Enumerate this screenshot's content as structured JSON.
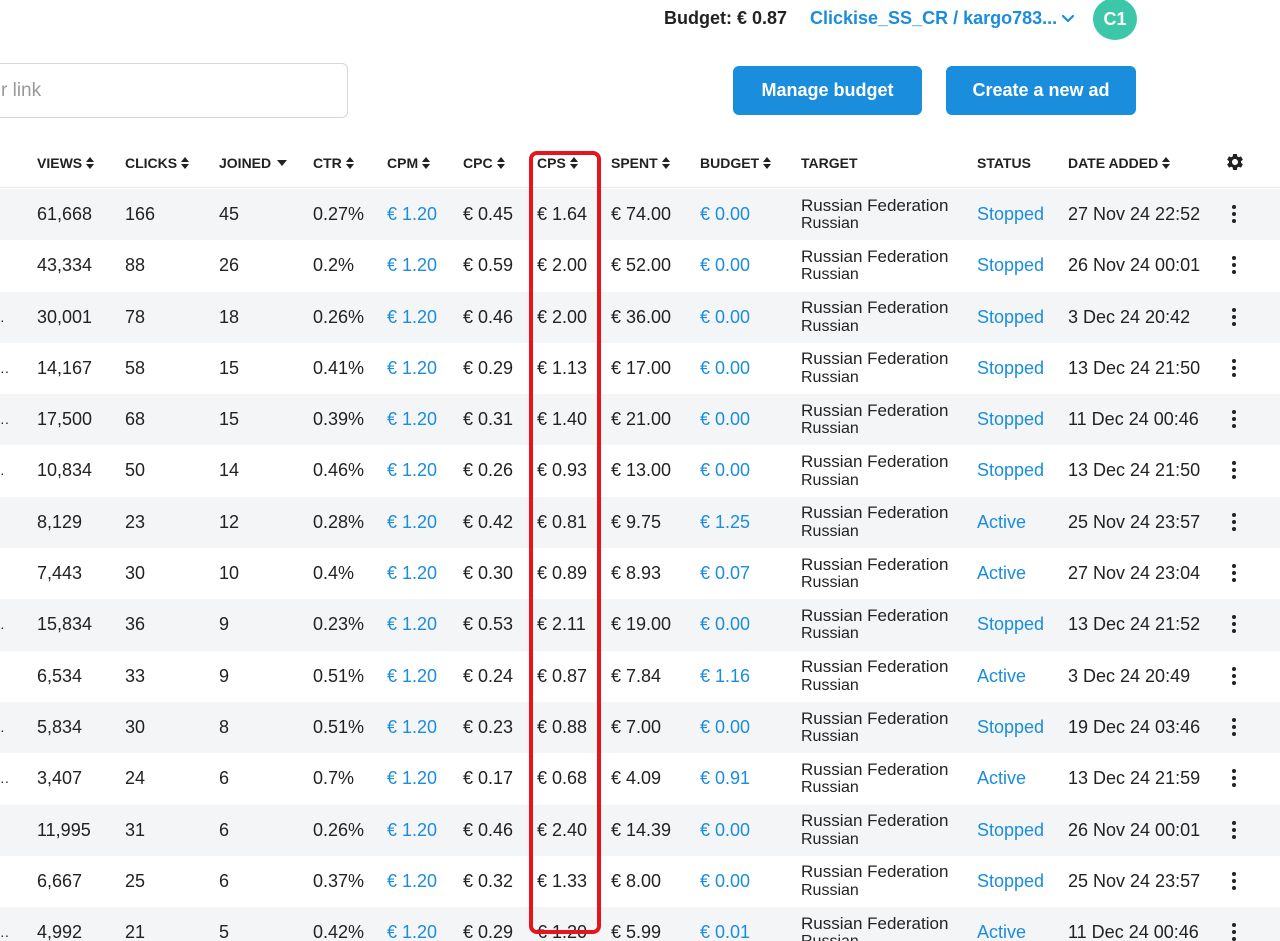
{
  "header": {
    "budget_label": "Budget: € 0.87",
    "account_name": "Clickise_SS_CR / kargo783...",
    "avatar_initials": "C1"
  },
  "search": {
    "placeholder": "r link"
  },
  "actions": {
    "manage_budget": "Manage budget",
    "create_ad": "Create a new ad"
  },
  "columns": {
    "views": "VIEWS",
    "clicks": "CLICKS",
    "joined": "JOINED",
    "ctr": "CTR",
    "cpm": "CPM",
    "cpc": "CPC",
    "cps": "CPS",
    "spent": "SPENT",
    "budget": "BUDGET",
    "target": "TARGET",
    "status": "STATUS",
    "date_added": "DATE ADDED"
  },
  "rows": [
    {
      "marker": "",
      "views": "61,668",
      "clicks": "166",
      "joined": "45",
      "ctr": "0.27%",
      "cpm": "€ 1.20",
      "cpc": "€ 0.45",
      "cps": "€ 1.64",
      "spent": "€ 74.00",
      "budget": "€ 0.00",
      "country": "Russian Federation",
      "lang": "Russian",
      "status": "Stopped",
      "date": "27 Nov 24 22:52"
    },
    {
      "marker": "",
      "views": "43,334",
      "clicks": "88",
      "joined": "26",
      "ctr": "0.2%",
      "cpm": "€ 1.20",
      "cpc": "€ 0.59",
      "cps": "€ 2.00",
      "spent": "€ 52.00",
      "budget": "€ 0.00",
      "country": "Russian Federation",
      "lang": "Russian",
      "status": "Stopped",
      "date": "26 Nov 24 00:01"
    },
    {
      "marker": "·",
      "views": "30,001",
      "clicks": "78",
      "joined": "18",
      "ctr": "0.26%",
      "cpm": "€ 1.20",
      "cpc": "€ 0.46",
      "cps": "€ 2.00",
      "spent": "€ 36.00",
      "budget": "€ 0.00",
      "country": "Russian Federation",
      "lang": "Russian",
      "status": "Stopped",
      "date": "3 Dec 24 20:42"
    },
    {
      "marker": "··",
      "views": "14,167",
      "clicks": "58",
      "joined": "15",
      "ctr": "0.41%",
      "cpm": "€ 1.20",
      "cpc": "€ 0.29",
      "cps": "€ 1.13",
      "spent": "€ 17.00",
      "budget": "€ 0.00",
      "country": "Russian Federation",
      "lang": "Russian",
      "status": "Stopped",
      "date": "13 Dec 24 21:50"
    },
    {
      "marker": "··",
      "views": "17,500",
      "clicks": "68",
      "joined": "15",
      "ctr": "0.39%",
      "cpm": "€ 1.20",
      "cpc": "€ 0.31",
      "cps": "€ 1.40",
      "spent": "€ 21.00",
      "budget": "€ 0.00",
      "country": "Russian Federation",
      "lang": "Russian",
      "status": "Stopped",
      "date": "11 Dec 24 00:46"
    },
    {
      "marker": "·",
      "views": "10,834",
      "clicks": "50",
      "joined": "14",
      "ctr": "0.46%",
      "cpm": "€ 1.20",
      "cpc": "€ 0.26",
      "cps": "€ 0.93",
      "spent": "€ 13.00",
      "budget": "€ 0.00",
      "country": "Russian Federation",
      "lang": "Russian",
      "status": "Stopped",
      "date": "13 Dec 24 21:50"
    },
    {
      "marker": "",
      "views": "8,129",
      "clicks": "23",
      "joined": "12",
      "ctr": "0.28%",
      "cpm": "€ 1.20",
      "cpc": "€ 0.42",
      "cps": "€ 0.81",
      "spent": "€ 9.75",
      "budget": "€ 1.25",
      "country": "Russian Federation",
      "lang": "Russian",
      "status": "Active",
      "date": "25 Nov 24 23:57"
    },
    {
      "marker": "",
      "views": "7,443",
      "clicks": "30",
      "joined": "10",
      "ctr": "0.4%",
      "cpm": "€ 1.20",
      "cpc": "€ 0.30",
      "cps": "€ 0.89",
      "spent": "€ 8.93",
      "budget": "€ 0.07",
      "country": "Russian Federation",
      "lang": "Russian",
      "status": "Active",
      "date": "27 Nov 24 23:04"
    },
    {
      "marker": "·",
      "views": "15,834",
      "clicks": "36",
      "joined": "9",
      "ctr": "0.23%",
      "cpm": "€ 1.20",
      "cpc": "€ 0.53",
      "cps": "€ 2.11",
      "spent": "€ 19.00",
      "budget": "€ 0.00",
      "country": "Russian Federation",
      "lang": "Russian",
      "status": "Stopped",
      "date": "13 Dec 24 21:52"
    },
    {
      "marker": "",
      "views": "6,534",
      "clicks": "33",
      "joined": "9",
      "ctr": "0.51%",
      "cpm": "€ 1.20",
      "cpc": "€ 0.24",
      "cps": "€ 0.87",
      "spent": "€ 7.84",
      "budget": "€ 1.16",
      "country": "Russian Federation",
      "lang": "Russian",
      "status": "Active",
      "date": "3 Dec 24 20:49"
    },
    {
      "marker": "·",
      "views": "5,834",
      "clicks": "30",
      "joined": "8",
      "ctr": "0.51%",
      "cpm": "€ 1.20",
      "cpc": "€ 0.23",
      "cps": "€ 0.88",
      "spent": "€ 7.00",
      "budget": "€ 0.00",
      "country": "Russian Federation",
      "lang": "Russian",
      "status": "Stopped",
      "date": "19 Dec 24 03:46"
    },
    {
      "marker": "··",
      "views": "3,407",
      "clicks": "24",
      "joined": "6",
      "ctr": "0.7%",
      "cpm": "€ 1.20",
      "cpc": "€ 0.17",
      "cps": "€ 0.68",
      "spent": "€ 4.09",
      "budget": "€ 0.91",
      "country": "Russian Federation",
      "lang": "Russian",
      "status": "Active",
      "date": "13 Dec 24 21:59"
    },
    {
      "marker": "",
      "views": "11,995",
      "clicks": "31",
      "joined": "6",
      "ctr": "0.26%",
      "cpm": "€ 1.20",
      "cpc": "€ 0.46",
      "cps": "€ 2.40",
      "spent": "€ 14.39",
      "budget": "€ 0.00",
      "country": "Russian Federation",
      "lang": "Russian",
      "status": "Stopped",
      "date": "26 Nov 24 00:01"
    },
    {
      "marker": "",
      "views": "6,667",
      "clicks": "25",
      "joined": "6",
      "ctr": "0.37%",
      "cpm": "€ 1.20",
      "cpc": "€ 0.32",
      "cps": "€ 1.33",
      "spent": "€ 8.00",
      "budget": "€ 0.00",
      "country": "Russian Federation",
      "lang": "Russian",
      "status": "Stopped",
      "date": "25 Nov 24 23:57"
    },
    {
      "marker": "··",
      "views": "4,992",
      "clicks": "21",
      "joined": "5",
      "ctr": "0.42%",
      "cpm": "€ 1.20",
      "cpc": "€ 0.29",
      "cps": "€ 1.20",
      "spent": "€ 5.99",
      "budget": "€ 0.01",
      "country": "Russian Federation",
      "lang": "Russian",
      "status": "Active",
      "date": "11 Dec 24 00:46"
    }
  ],
  "colors": {
    "accent": "#1a8ddc",
    "highlight": "#e8141b",
    "avatar": "#3cc8a8",
    "row_alt": "#f4f5f7"
  },
  "icons": {
    "chevron": "chevron-down-icon",
    "settings": "gear-icon",
    "row_menu": "kebab-icon",
    "sort": "sort-icon"
  }
}
